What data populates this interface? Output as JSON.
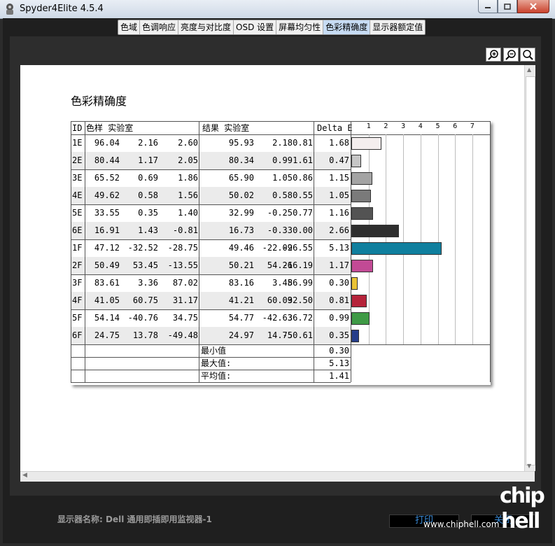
{
  "window": {
    "title": "Spyder4Elite 4.5.4"
  },
  "tabs": [
    {
      "label": "色域",
      "active": false
    },
    {
      "label": "色调响应",
      "active": false
    },
    {
      "label": "亮度与对比度",
      "active": false
    },
    {
      "label": "OSD 设置",
      "active": false
    },
    {
      "label": "屏幕均匀性",
      "active": false
    },
    {
      "label": "色彩精确度",
      "active": true
    },
    {
      "label": "显示器额定值",
      "active": false
    }
  ],
  "report": {
    "title": "色彩精确度",
    "headers": {
      "id": "ID",
      "sample": "色样 实验室",
      "result": "结果 实验室",
      "delta": "Delta E"
    },
    "scale_labels": [
      "1",
      "2",
      "3",
      "4",
      "5",
      "6",
      "7"
    ],
    "rows": [
      {
        "id": "1E",
        "s": [
          "96.04",
          "2.16",
          "2.60"
        ],
        "r": [
          "95.93",
          "2.18",
          "0.81"
        ],
        "de": "1.68",
        "color": "#f4eeee"
      },
      {
        "id": "2E",
        "s": [
          "80.44",
          "1.17",
          "2.05"
        ],
        "r": [
          "80.34",
          "0.99",
          "1.61"
        ],
        "de": "0.47",
        "color": "#c6c6c6"
      },
      {
        "id": "3E",
        "s": [
          "65.52",
          "0.69",
          "1.86"
        ],
        "r": [
          "65.90",
          "1.05",
          "0.86"
        ],
        "de": "1.15",
        "color": "#a3a3a3"
      },
      {
        "id": "4E",
        "s": [
          "49.62",
          "0.58",
          "1.56"
        ],
        "r": [
          "50.02",
          "0.58",
          "0.55"
        ],
        "de": "1.05",
        "color": "#7a7a7a"
      },
      {
        "id": "5E",
        "s": [
          "33.55",
          "0.35",
          "1.40"
        ],
        "r": [
          "32.99",
          "-0.25",
          "0.77"
        ],
        "de": "1.16",
        "color": "#535353"
      },
      {
        "id": "6E",
        "s": [
          "16.91",
          "1.43",
          "-0.81"
        ],
        "r": [
          "16.73",
          "-0.33",
          "0.00"
        ],
        "de": "2.66",
        "color": "#2e2e2e"
      },
      {
        "id": "1F",
        "s": [
          "47.12",
          "-32.52",
          "-28.75"
        ],
        "r": [
          "49.46",
          "-22.09",
          "-26.55"
        ],
        "de": "5.13",
        "color": "#0f7f9e"
      },
      {
        "id": "2F",
        "s": [
          "50.49",
          "53.45",
          "-13.55"
        ],
        "r": [
          "50.21",
          "54.26",
          "-16.19"
        ],
        "de": "1.17",
        "color": "#c24a95"
      },
      {
        "id": "3F",
        "s": [
          "83.61",
          "3.36",
          "87.02"
        ],
        "r": [
          "83.16",
          "3.45",
          "86.99"
        ],
        "de": "0.30",
        "color": "#e9c235"
      },
      {
        "id": "4F",
        "s": [
          "41.05",
          "60.75",
          "31.17"
        ],
        "r": [
          "41.21",
          "60.09",
          "32.50"
        ],
        "de": "0.81",
        "color": "#b5233a"
      },
      {
        "id": "5F",
        "s": [
          "54.14",
          "-40.76",
          "34.75"
        ],
        "r": [
          "54.77",
          "-42.63",
          "36.72"
        ],
        "de": "0.99",
        "color": "#3e9a45"
      },
      {
        "id": "6F",
        "s": [
          "24.75",
          "13.78",
          "-49.48"
        ],
        "r": [
          "24.97",
          "14.75",
          "-50.61"
        ],
        "de": "0.35",
        "color": "#253d8a"
      }
    ],
    "summary": [
      {
        "label": "最小值",
        "value": "0.30"
      },
      {
        "label": "最大值:",
        "value": "5.13"
      },
      {
        "label": "平均值:",
        "value": "1.41"
      }
    ]
  },
  "footer": {
    "monitor_label": "显示器名称: Dell 通用即插即用监视器-1",
    "print": "打印",
    "close": "关闭",
    "watermark": "www.chiphell.com",
    "brand": "chip hell"
  }
}
